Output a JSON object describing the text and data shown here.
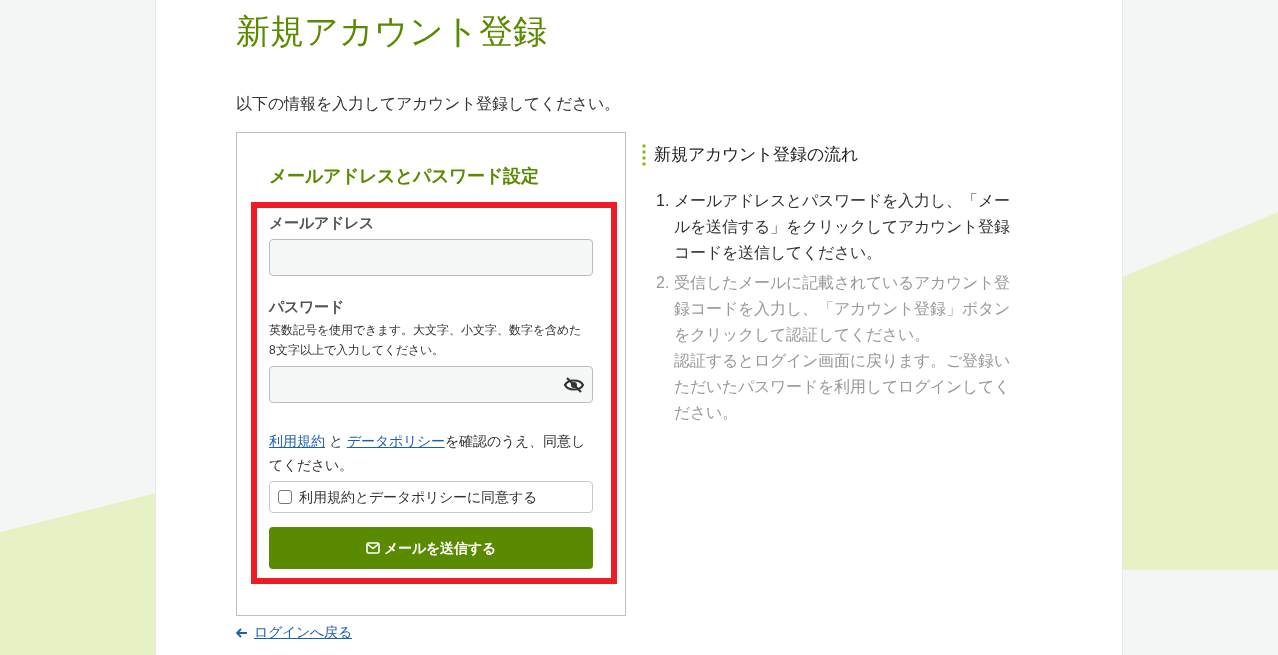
{
  "page_title": "新規アカウント登録",
  "intro": "以下の情報を入力してアカウント登録してください。",
  "form": {
    "heading": "メールアドレスとパスワード設定",
    "highlighted": true,
    "email": {
      "label": "メールアドレス"
    },
    "password": {
      "label": "パスワード",
      "hint": "英数記号を使用できます。大文字、小文字、数字を含めた8文字以上で入力してください。",
      "visible": false
    },
    "consent_text": [
      {
        "kind": "link",
        "text": "利用規約"
      },
      {
        "kind": "text",
        "text": " と "
      },
      {
        "kind": "link",
        "text": "データポリシー"
      },
      {
        "kind": "text",
        "text": "を確認のうえ、同意してください。"
      }
    ],
    "agree": {
      "label": "利用規約とデータポリシーに同意する",
      "checked": false
    },
    "submit": "メールを送信する"
  },
  "back_link": "ログインへ戻る",
  "flow": {
    "title": "新規アカウント登録の流れ",
    "steps": [
      {
        "number": "1.",
        "active": true,
        "paragraphs": [
          "メールアドレスとパスワードを入力し、「メールを送信する」をクリックしてアカウント登録コードを送信してください。"
        ]
      },
      {
        "number": "2.",
        "active": false,
        "paragraphs": [
          "受信したメールに記載されているアカウント登録コードを入力し、「アカウント登録」ボタンをクリックして認証してください。",
          "認証するとログイン画面に戻ります。ご登録いただいたパスワードを利用してログインしてください。"
        ]
      }
    ]
  }
}
